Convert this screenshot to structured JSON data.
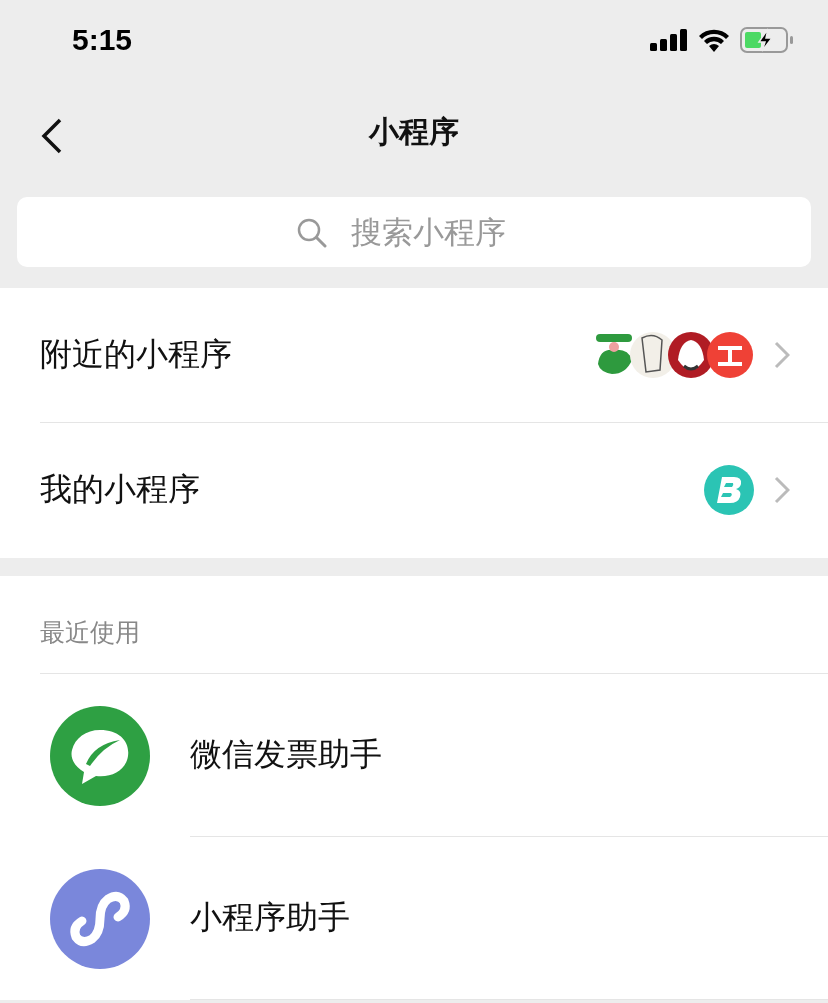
{
  "status_bar": {
    "time": "5:15"
  },
  "nav": {
    "title": "小程序"
  },
  "search": {
    "placeholder": "搜索小程序"
  },
  "entries": [
    {
      "label": "附近的小程序",
      "kind": "nearby"
    },
    {
      "label": "我的小程序",
      "kind": "mine"
    }
  ],
  "recent": {
    "header": "最近使用",
    "items": [
      {
        "name": "微信发票助手",
        "kind": "invoice"
      },
      {
        "name": "小程序助手",
        "kind": "assistant"
      }
    ]
  }
}
